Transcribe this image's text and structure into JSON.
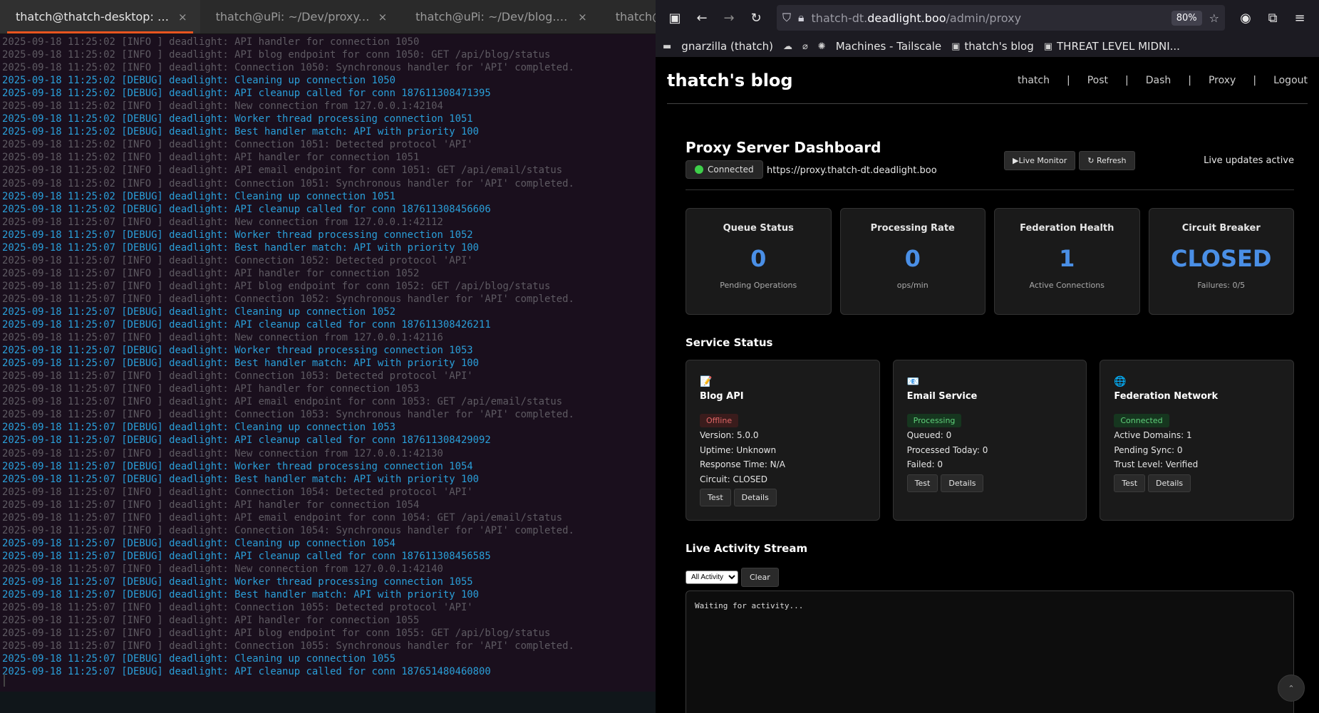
{
  "terminal": {
    "tabs": [
      {
        "title": "thatch@thatch-desktop: ~/De...",
        "active": true
      },
      {
        "title": "thatch@uPi: ~/Dev/proxy.dea...",
        "active": false
      },
      {
        "title": "thatch@uPi: ~/Dev/blog.deadl...",
        "active": false
      },
      {
        "title": "thatch@th",
        "active": false
      }
    ],
    "close_glyph": "×",
    "lines": [
      {
        "level": "info",
        "text": "2025-09-18 11:25:02 [INFO ] deadlight: API handler for connection 1050"
      },
      {
        "level": "info",
        "text": "2025-09-18 11:25:02 [INFO ] deadlight: API blog endpoint for conn 1050: GET /api/blog/status"
      },
      {
        "level": "info",
        "text": "2025-09-18 11:25:02 [INFO ] deadlight: Connection 1050: Synchronous handler for 'API' completed."
      },
      {
        "level": "debug",
        "text": "2025-09-18 11:25:02 [DEBUG] deadlight: Cleaning up connection 1050"
      },
      {
        "level": "debug",
        "text": "2025-09-18 11:25:02 [DEBUG] deadlight: API cleanup called for conn 187611308471395"
      },
      {
        "level": "info",
        "text": "2025-09-18 11:25:02 [INFO ] deadlight: New connection from 127.0.0.1:42104"
      },
      {
        "level": "debug",
        "text": "2025-09-18 11:25:02 [DEBUG] deadlight: Worker thread processing connection 1051"
      },
      {
        "level": "debug",
        "text": "2025-09-18 11:25:02 [DEBUG] deadlight: Best handler match: API with priority 100"
      },
      {
        "level": "info",
        "text": "2025-09-18 11:25:02 [INFO ] deadlight: Connection 1051: Detected protocol 'API'"
      },
      {
        "level": "info",
        "text": "2025-09-18 11:25:02 [INFO ] deadlight: API handler for connection 1051"
      },
      {
        "level": "info",
        "text": "2025-09-18 11:25:02 [INFO ] deadlight: API email endpoint for conn 1051: GET /api/email/status"
      },
      {
        "level": "info",
        "text": "2025-09-18 11:25:02 [INFO ] deadlight: Connection 1051: Synchronous handler for 'API' completed."
      },
      {
        "level": "debug",
        "text": "2025-09-18 11:25:02 [DEBUG] deadlight: Cleaning up connection 1051"
      },
      {
        "level": "debug",
        "text": "2025-09-18 11:25:02 [DEBUG] deadlight: API cleanup called for conn 187611308456606"
      },
      {
        "level": "info",
        "text": "2025-09-18 11:25:07 [INFO ] deadlight: New connection from 127.0.0.1:42112"
      },
      {
        "level": "debug",
        "text": "2025-09-18 11:25:07 [DEBUG] deadlight: Worker thread processing connection 1052"
      },
      {
        "level": "debug",
        "text": "2025-09-18 11:25:07 [DEBUG] deadlight: Best handler match: API with priority 100"
      },
      {
        "level": "info",
        "text": "2025-09-18 11:25:07 [INFO ] deadlight: Connection 1052: Detected protocol 'API'"
      },
      {
        "level": "info",
        "text": "2025-09-18 11:25:07 [INFO ] deadlight: API handler for connection 1052"
      },
      {
        "level": "info",
        "text": "2025-09-18 11:25:07 [INFO ] deadlight: API blog endpoint for conn 1052: GET /api/blog/status"
      },
      {
        "level": "info",
        "text": "2025-09-18 11:25:07 [INFO ] deadlight: Connection 1052: Synchronous handler for 'API' completed."
      },
      {
        "level": "debug",
        "text": "2025-09-18 11:25:07 [DEBUG] deadlight: Cleaning up connection 1052"
      },
      {
        "level": "debug",
        "text": "2025-09-18 11:25:07 [DEBUG] deadlight: API cleanup called for conn 187611308426211"
      },
      {
        "level": "info",
        "text": "2025-09-18 11:25:07 [INFO ] deadlight: New connection from 127.0.0.1:42116"
      },
      {
        "level": "debug",
        "text": "2025-09-18 11:25:07 [DEBUG] deadlight: Worker thread processing connection 1053"
      },
      {
        "level": "debug",
        "text": "2025-09-18 11:25:07 [DEBUG] deadlight: Best handler match: API with priority 100"
      },
      {
        "level": "info",
        "text": "2025-09-18 11:25:07 [INFO ] deadlight: Connection 1053: Detected protocol 'API'"
      },
      {
        "level": "info",
        "text": "2025-09-18 11:25:07 [INFO ] deadlight: API handler for connection 1053"
      },
      {
        "level": "info",
        "text": "2025-09-18 11:25:07 [INFO ] deadlight: API email endpoint for conn 1053: GET /api/email/status"
      },
      {
        "level": "info",
        "text": "2025-09-18 11:25:07 [INFO ] deadlight: Connection 1053: Synchronous handler for 'API' completed."
      },
      {
        "level": "debug",
        "text": "2025-09-18 11:25:07 [DEBUG] deadlight: Cleaning up connection 1053"
      },
      {
        "level": "debug",
        "text": "2025-09-18 11:25:07 [DEBUG] deadlight: API cleanup called for conn 187611308429092"
      },
      {
        "level": "info",
        "text": "2025-09-18 11:25:07 [INFO ] deadlight: New connection from 127.0.0.1:42130"
      },
      {
        "level": "debug",
        "text": "2025-09-18 11:25:07 [DEBUG] deadlight: Worker thread processing connection 1054"
      },
      {
        "level": "debug",
        "text": "2025-09-18 11:25:07 [DEBUG] deadlight: Best handler match: API with priority 100"
      },
      {
        "level": "info",
        "text": "2025-09-18 11:25:07 [INFO ] deadlight: Connection 1054: Detected protocol 'API'"
      },
      {
        "level": "info",
        "text": "2025-09-18 11:25:07 [INFO ] deadlight: API handler for connection 1054"
      },
      {
        "level": "info",
        "text": "2025-09-18 11:25:07 [INFO ] deadlight: API email endpoint for conn 1054: GET /api/email/status"
      },
      {
        "level": "info",
        "text": "2025-09-18 11:25:07 [INFO ] deadlight: Connection 1054: Synchronous handler for 'API' completed."
      },
      {
        "level": "debug",
        "text": "2025-09-18 11:25:07 [DEBUG] deadlight: Cleaning up connection 1054"
      },
      {
        "level": "debug",
        "text": "2025-09-18 11:25:07 [DEBUG] deadlight: API cleanup called for conn 187611308456585"
      },
      {
        "level": "info",
        "text": "2025-09-18 11:25:07 [INFO ] deadlight: New connection from 127.0.0.1:42140"
      },
      {
        "level": "debug",
        "text": "2025-09-18 11:25:07 [DEBUG] deadlight: Worker thread processing connection 1055"
      },
      {
        "level": "debug",
        "text": "2025-09-18 11:25:07 [DEBUG] deadlight: Best handler match: API with priority 100"
      },
      {
        "level": "info",
        "text": "2025-09-18 11:25:07 [INFO ] deadlight: Connection 1055: Detected protocol 'API'"
      },
      {
        "level": "info",
        "text": "2025-09-18 11:25:07 [INFO ] deadlight: API handler for connection 1055"
      },
      {
        "level": "info",
        "text": "2025-09-18 11:25:07 [INFO ] deadlight: API blog endpoint for conn 1055: GET /api/blog/status"
      },
      {
        "level": "info",
        "text": "2025-09-18 11:25:07 [INFO ] deadlight: Connection 1055: Synchronous handler for 'API' completed."
      },
      {
        "level": "debug",
        "text": "2025-09-18 11:25:07 [DEBUG] deadlight: Cleaning up connection 1055"
      },
      {
        "level": "debug",
        "text": "2025-09-18 11:25:07 [DEBUG] deadlight: API cleanup called for conn 187651480460800"
      }
    ]
  },
  "browser": {
    "url_host_prefix": "thatch-dt.",
    "url_host_main": "deadlight.boo",
    "url_path": "/admin/proxy",
    "zoom": "80%",
    "bookmarks": [
      {
        "icon": "▬",
        "label": ""
      },
      {
        "icon": "",
        "label": "gnarzilla (thatch)"
      },
      {
        "icon": "☁",
        "label": ""
      },
      {
        "icon": "⌀",
        "label": ""
      },
      {
        "icon": "✺",
        "label": ""
      },
      {
        "icon": "",
        "label": "Machines - Tailscale"
      },
      {
        "icon": "▣",
        "label": "thatch's blog"
      },
      {
        "icon": "▣",
        "label": "THREAT LEVEL MIDNI..."
      }
    ]
  },
  "site": {
    "title": "thatch's blog",
    "nav": [
      "thatch",
      "Post",
      "Dash",
      "Proxy",
      "Logout"
    ],
    "nav_sep": "|"
  },
  "dashboard": {
    "title": "Proxy Server Dashboard",
    "connection_status": "Connected",
    "proxy_url": "https://proxy.thatch-dt.deadlight.boo",
    "live_monitor_label": "▶Live Monitor",
    "refresh_label": "↻ Refresh",
    "live_status": "Live updates active",
    "stats": [
      {
        "title": "Queue Status",
        "value": "0",
        "sub": "Pending Operations"
      },
      {
        "title": "Processing Rate",
        "value": "0",
        "sub": "ops/min"
      },
      {
        "title": "Federation Health",
        "value": "1",
        "sub": "Active Connections"
      },
      {
        "title": "Circuit Breaker",
        "value": "CLOSED",
        "sub": "Failures: 0/5"
      }
    ],
    "service_status_title": "Service Status",
    "services": [
      {
        "icon": "📝",
        "name": "Blog API",
        "status": "Offline",
        "status_kind": "off",
        "details": [
          "Version: 5.0.0",
          "Uptime: Unknown",
          "Response Time: N/A",
          "Circuit: CLOSED"
        ]
      },
      {
        "icon": "📧",
        "name": "Email Service",
        "status": "Processing",
        "status_kind": "ok",
        "details": [
          "Queued: 0",
          "Processed Today: 0",
          "Failed: 0"
        ]
      },
      {
        "icon": "🌐",
        "name": "Federation Network",
        "status": "Connected",
        "status_kind": "ok",
        "details": [
          "Active Domains: 1",
          "Pending Sync: 0",
          "Trust Level: Verified"
        ]
      }
    ],
    "test_label": "Test",
    "details_label": "Details",
    "activity_title": "Live Activity Stream",
    "activity_filter": "All Activity",
    "clear_label": "Clear",
    "activity_text": "Waiting for activity..."
  },
  "colors": {
    "accent_blue": "#4a8fe6",
    "debug_text": "#2a9fd9",
    "info_text": "#5e5a62",
    "terminal_tab_accent": "#e95420"
  }
}
